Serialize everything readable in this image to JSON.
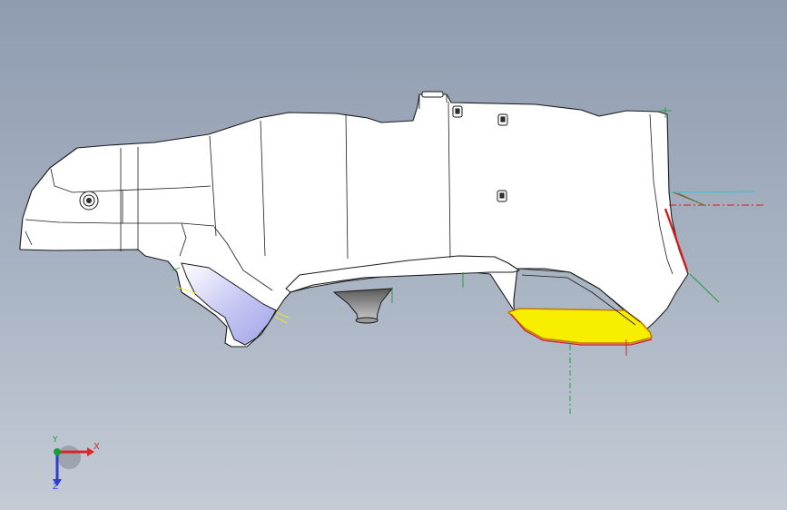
{
  "viewport": {
    "background_top": "#8f9cb0",
    "background_bottom": "#c4cbd5"
  },
  "model": {
    "part": "automotive-plastic-trim-panel",
    "body_color": "#ffffff",
    "edge_color": "#1a1a1a",
    "highlight_face_color": "#f7ee00",
    "highlight_edge_color": "#d41e1e",
    "shaded_face_color": "#b6b8ee"
  },
  "triad": {
    "x_label": "X",
    "y_label": "Y",
    "z_label": "Z",
    "x_color": "#d42a2a",
    "y_color": "#1d9a3a",
    "z_color": "#2a3fcf"
  }
}
